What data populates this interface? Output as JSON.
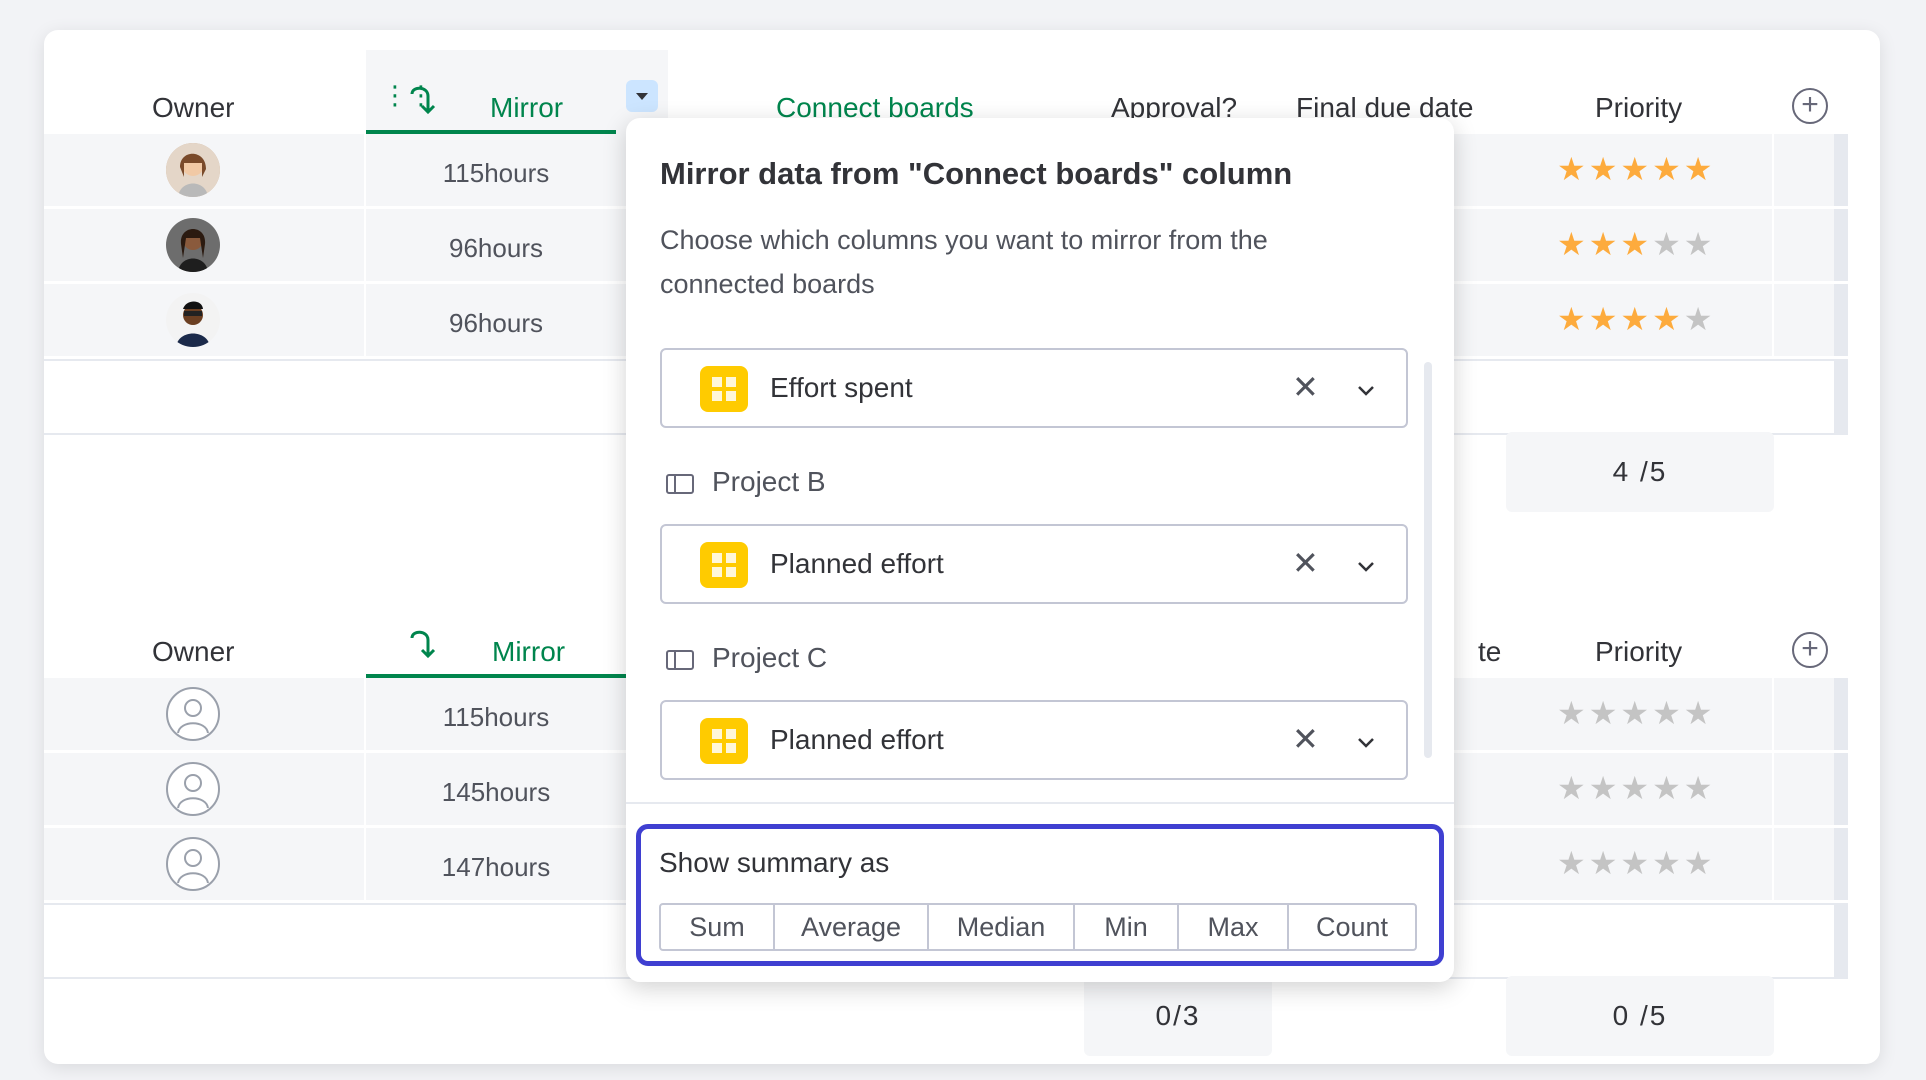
{
  "board_top": {
    "headers": {
      "owner": "Owner",
      "mirror": "Mirror",
      "connect_boards": "Connect boards",
      "approval": "Approval?",
      "final_due_date": "Final due date",
      "priority": "Priority"
    },
    "rows": [
      {
        "hours": "115hours",
        "stars": 5
      },
      {
        "hours": "96hours",
        "stars": 3
      },
      {
        "hours": "96hours",
        "stars": 4
      }
    ],
    "priority_summary": "4 /5"
  },
  "board_bottom": {
    "headers": {
      "owner": "Owner",
      "mirror": "Mirror",
      "date_partial": "te",
      "priority": "Priority"
    },
    "rows": [
      {
        "hours": "115hours",
        "stars": 0
      },
      {
        "hours": "145hours",
        "stars": 0
      },
      {
        "hours": "147hours",
        "stars": 0
      }
    ],
    "approval_summary": "0/3",
    "priority_summary": "0 /5"
  },
  "popup": {
    "title": "Mirror data from \"Connect boards\" column",
    "description": "Choose which columns you want to mirror from the connected boards",
    "selects": [
      {
        "project": "",
        "value": "Effort spent"
      },
      {
        "project": "Project B",
        "value": "Planned effort"
      },
      {
        "project": "Project C",
        "value": "Planned effort"
      }
    ],
    "summary": {
      "title": "Show summary as",
      "options": [
        "Sum",
        "Average",
        "Median",
        "Min",
        "Max",
        "Count"
      ]
    }
  },
  "colors": {
    "accent_green": "#00854d",
    "star": "#fdab3d",
    "highlight": "#3f3fd1",
    "column_icon": "#ffcb00"
  }
}
